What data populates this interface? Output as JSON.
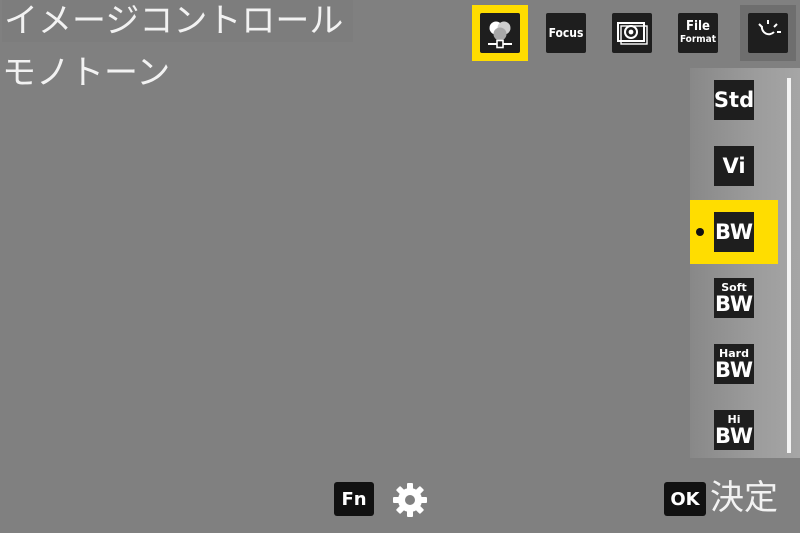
{
  "header": {
    "title": "イメージコントロール",
    "subtitle": "モノトーン"
  },
  "tabs": [
    {
      "name": "image-control",
      "icon": "image-control-icon",
      "label": "",
      "selected": true
    },
    {
      "name": "focus",
      "icon": "focus-icon",
      "label": "Focus",
      "selected": false
    },
    {
      "name": "stabilizer",
      "icon": "stabilizer-icon",
      "label": "",
      "selected": false
    },
    {
      "name": "file-format",
      "icon": "file-format-icon",
      "label": "File",
      "label2": "Format",
      "selected": false
    },
    {
      "name": "exposure",
      "icon": "sun-icon",
      "label": "",
      "selected": false
    }
  ],
  "list": {
    "items": [
      {
        "small": "",
        "big": "Std",
        "selected": false
      },
      {
        "small": "",
        "big": "Vi",
        "selected": false
      },
      {
        "small": "",
        "big": "BW",
        "selected": true
      },
      {
        "small": "Soft",
        "big": "BW",
        "selected": false
      },
      {
        "small": "Hard",
        "big": "BW",
        "selected": false
      },
      {
        "small": "Hi",
        "big": "BW",
        "selected": false
      }
    ]
  },
  "footer": {
    "fn_label": "Fn",
    "ok_label": "OK",
    "confirm_label": "決定"
  },
  "colors": {
    "background": "#808080",
    "accent": "#ffdd00",
    "icon_bg": "#1e1e1e"
  }
}
